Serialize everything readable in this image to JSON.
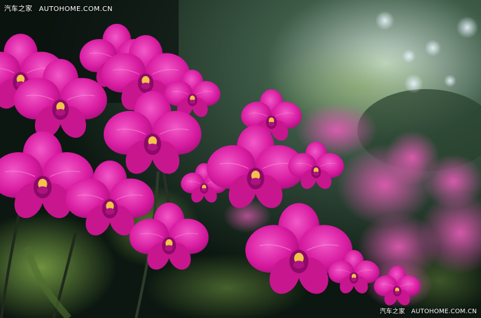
{
  "watermark_top": {
    "brand": "汽车之家",
    "site": "AUTOHOME.COM.CN"
  },
  "watermark_bottom": {
    "brand": "汽车之家",
    "site": "AUTOHOME.COM.CN"
  },
  "colors": {
    "petal": "#d81ba0",
    "petal_light": "#f04bc0",
    "petal_dark": "#a70d78",
    "background_foliage": "#1d3a26",
    "foliage_light": "#6e9a3c",
    "center": "#f3c24a"
  }
}
